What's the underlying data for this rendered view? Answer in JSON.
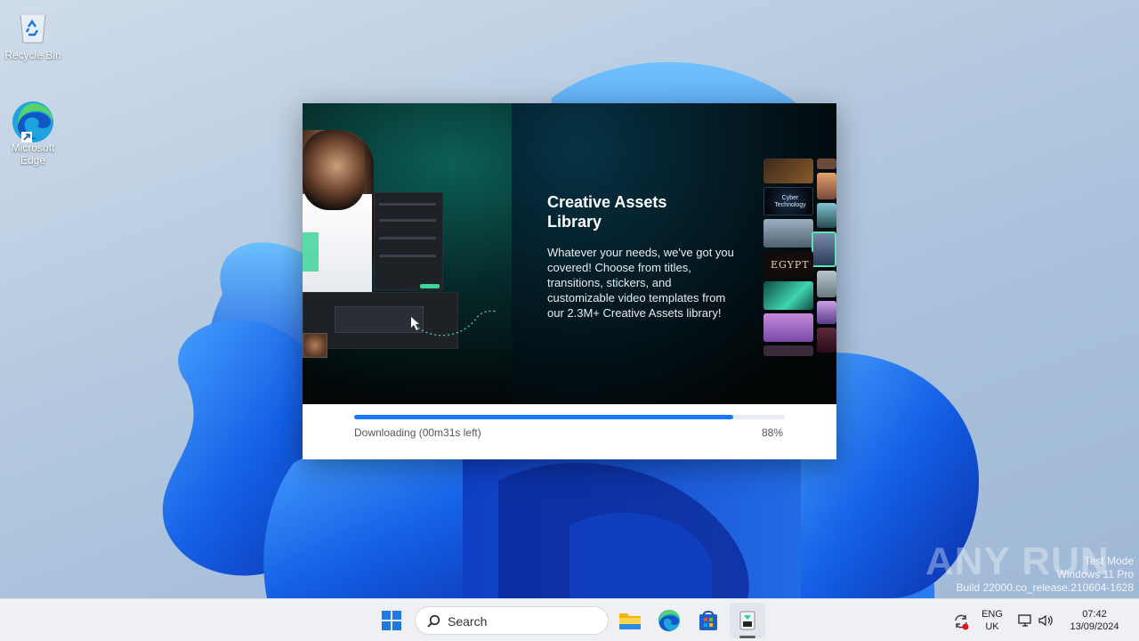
{
  "desktop": {
    "icons": [
      {
        "label": "Recycle Bin",
        "icon": "recycle-bin-icon"
      },
      {
        "label": "Microsoft Edge",
        "icon": "edge-icon"
      }
    ]
  },
  "installer": {
    "hero": {
      "title": "Creative Assets Library",
      "description": "Whatever your needs, we've got you covered! Choose from titles, transitions, stickers, and customizable video templates from our 2.3M+ Creative Assets library!",
      "thumb_labels": [
        "Cyber Technology",
        "EGYPT"
      ]
    },
    "progress": {
      "status": "Downloading (00m31s left)",
      "percent_label": "88%",
      "value": 0.88,
      "fill_color": "#1677ff"
    }
  },
  "taskbar": {
    "search_label": "Search",
    "apps": [
      "start-icon",
      "file-explorer-icon",
      "edge-icon",
      "microsoft-store-icon",
      "installer-app-icon"
    ],
    "tray": {
      "lang_line1": "ENG",
      "lang_line2": "UK",
      "time": "07:42",
      "date": "13/09/2024"
    }
  },
  "watermark": {
    "line1": "Test Mode",
    "line2": "Windows 11 Pro",
    "line3": "Build 22000.co_release.210604-1628",
    "brand": "ANY RUN"
  }
}
